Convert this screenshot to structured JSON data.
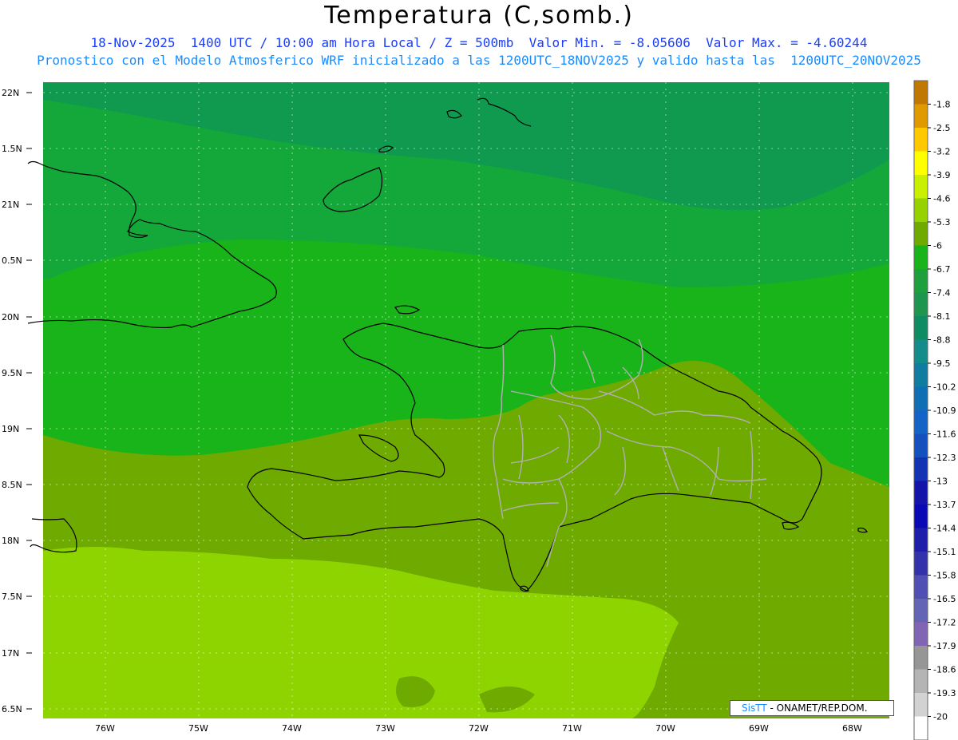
{
  "header": {
    "title": "Temperatura (C,somb.)",
    "subtitle_1": "18-Nov-2025  1400 UTC / 10:00 am Hora Local / Z = 500mb  Valor Min. = -8.05606  Valor Max. = -4.60244",
    "subtitle_2": "Pronostico con el Modelo Atmosferico WRF inicializado a las 1200UTC_18NOV2025 y valido hasta las  1200UTC_20NOV2025"
  },
  "map": {
    "lat_labels": [
      "22N",
      "1.5N",
      "21N",
      "0.5N",
      "20N",
      "9.5N",
      "19N",
      "8.5N",
      "18N",
      "7.5N",
      "17N",
      "6.5N"
    ],
    "lon_labels": [
      "76W",
      "75W",
      "74W",
      "73W",
      "72W",
      "71W",
      "70W",
      "69W",
      "68W"
    ]
  },
  "colorbar": {
    "levels": [
      "-1.8",
      "-2.5",
      "-3.2",
      "-3.9",
      "-4.6",
      "-5.3",
      "-6",
      "-6.7",
      "-7.4",
      "-8.1",
      "-8.8",
      "-9.5",
      "-10.2",
      "-10.9",
      "-11.6",
      "-12.3",
      "-13",
      "-13.7",
      "-14.4",
      "-15.1",
      "-15.8",
      "-16.5",
      "-17.2",
      "-17.9",
      "-18.6",
      "-19.3",
      "-20"
    ],
    "colors": [
      "#c07800",
      "#e09a00",
      "#ffc800",
      "#ffff00",
      "#c8f000",
      "#96d200",
      "#6eaa00",
      "#19b419",
      "#1ea03c",
      "#1e9650",
      "#0f8c64",
      "#148c8c",
      "#0f7ca0",
      "#0f6eb4",
      "#1464c8",
      "#1450be",
      "#1432b4",
      "#1414aa",
      "#0a0ab4",
      "#1e1eaa",
      "#3232aa",
      "#5050b4",
      "#6464b4",
      "#8264b4",
      "#969696",
      "#b4b4b4",
      "#d2d2d2"
    ],
    "bottom_color": "#ffffff"
  },
  "credit": {
    "brand": "SisTT",
    "org": " - ONAMET/REP.DOM."
  }
}
